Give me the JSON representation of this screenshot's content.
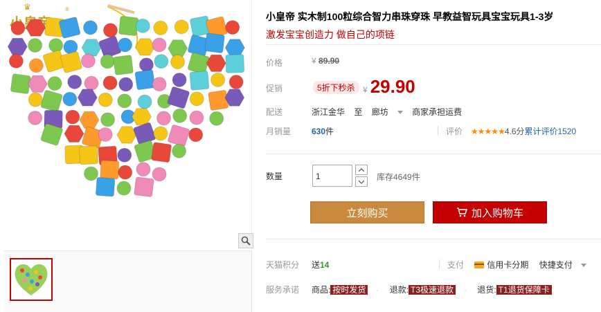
{
  "brand": {
    "logo_text": "小皇帝",
    "registered_mark": "®"
  },
  "gallery": {
    "zoom_icon": "magnifier-icon",
    "main_image_alt": "heart-shaped wooden beads"
  },
  "product": {
    "title": "小皇帝 实木制100粒综合智力串珠穿珠 早教益智玩具宝宝玩具1-3岁",
    "subtitle": "激发宝宝创造力 做自己的项链"
  },
  "price": {
    "label": "价格",
    "currency": "¥",
    "original": "89.90"
  },
  "promo": {
    "label": "促销",
    "tag": "5折下秒杀",
    "currency": "¥",
    "price": "29.90"
  },
  "delivery": {
    "label": "配送",
    "from": "浙江金华",
    "to_word": "至",
    "to": "廊坊",
    "shipping": "商家承担运费"
  },
  "sales": {
    "label": "月销量",
    "count": "630",
    "unit": "件"
  },
  "rating": {
    "label": "评价",
    "stars": "★★★★★",
    "score": "4.6分",
    "reviews_text": "累计评价1520"
  },
  "quantity": {
    "label": "数量",
    "value": "1",
    "stock": "库存4649件",
    "up_icon": "chevron-up-icon",
    "down_icon": "chevron-down-icon"
  },
  "actions": {
    "buy_now": "立刻购买",
    "add_to_cart": "加入购物车",
    "cart_icon": "shopping-cart-icon"
  },
  "points": {
    "label": "天猫积分",
    "prefix": "送",
    "value": "14"
  },
  "payment": {
    "label": "支付",
    "credit_card": "信用卡分期",
    "quick_pay": "快捷支付"
  },
  "services": {
    "label": "服务承诺",
    "items": [
      {
        "prefix": "商品:",
        "tag": "按时发货"
      },
      {
        "prefix": "退款:",
        "tag": "T3极速退款"
      },
      {
        "prefix": "退货:",
        "tag": "T1退货保障卡"
      }
    ]
  },
  "colors": {
    "accent_red": "#c40000",
    "buy_button": "#c98a40",
    "link_blue": "#2263a8",
    "points_green": "#339933"
  }
}
